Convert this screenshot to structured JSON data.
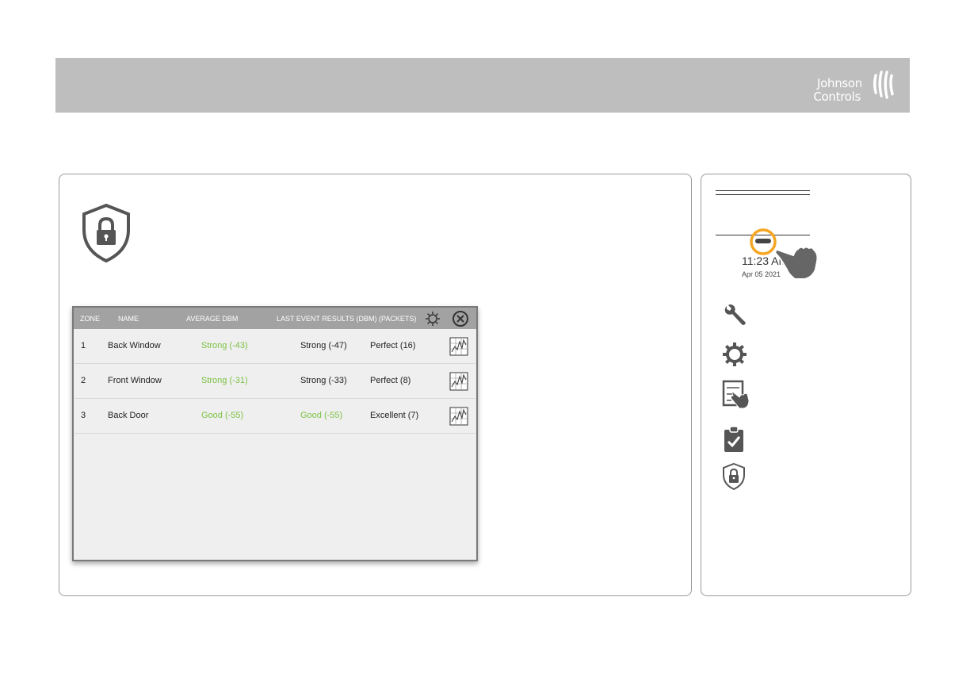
{
  "brand": {
    "line1": "Johnson",
    "line2": "Controls"
  },
  "device": {
    "time": "11:23 AM",
    "date": "Apr 05 2021"
  },
  "table": {
    "headers": {
      "zone": "ZONE",
      "name": "NAME",
      "avg": "AVERAGE DBM",
      "last": "LAST EVENT RESULTS (DBM) (PACKETS)"
    },
    "rows": [
      {
        "zone": "1",
        "name": "Back Window",
        "avg": "Strong (-43)",
        "last": "Strong (-47)",
        "packets": "Perfect (16)"
      },
      {
        "zone": "2",
        "name": "Front Window",
        "avg": "Strong (-31)",
        "last": "Strong (-33)",
        "packets": "Perfect (8)"
      },
      {
        "zone": "3",
        "name": "Back Door",
        "avg": "Good (-55)",
        "last": "Good (-55)",
        "packets": "Excellent (7)"
      }
    ]
  },
  "colors": {
    "header_bar": "#bebebe",
    "good_signal": "#7cc243",
    "highlight_ring": "#f5a623"
  },
  "icons": [
    "shield-lock-icon",
    "settings-gear-icon",
    "close-circle-icon",
    "signal-graph-icon",
    "wrench-icon",
    "gear-icon",
    "touch-screen-icon",
    "clipboard-check-icon",
    "minus-button-icon",
    "hand-pointer-icon"
  ]
}
